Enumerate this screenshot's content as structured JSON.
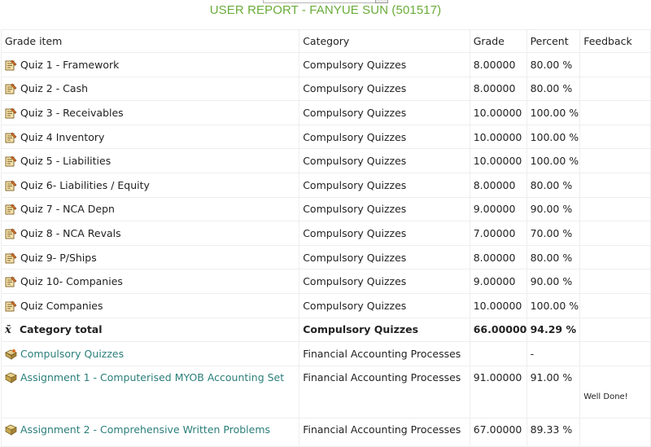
{
  "report_title": "USER REPORT - FANYUE SUN (501517)",
  "columns": {
    "item": "Grade item",
    "category": "Category",
    "grade": "Grade",
    "percent": "Percent",
    "feedback": "Feedback"
  },
  "rows": [
    {
      "item": "Quiz 1 - Framework",
      "category": "Compulsory Quizzes",
      "grade": "8.00000",
      "percent": "80.00 %",
      "feedback": ""
    },
    {
      "item": "Quiz 2 - Cash",
      "category": "Compulsory Quizzes",
      "grade": "8.00000",
      "percent": "80.00 %",
      "feedback": ""
    },
    {
      "item": "Quiz 3 - Receivables",
      "category": "Compulsory Quizzes",
      "grade": "10.00000",
      "percent": "100.00 %",
      "feedback": ""
    },
    {
      "item": "Quiz 4 Inventory",
      "category": "Compulsory Quizzes",
      "grade": "10.00000",
      "percent": "100.00 %",
      "feedback": ""
    },
    {
      "item": "Quiz 5 - Liabilities",
      "category": "Compulsory Quizzes",
      "grade": "10.00000",
      "percent": "100.00 %",
      "feedback": ""
    },
    {
      "item": "Quiz 6- Liabilities / Equity",
      "category": "Compulsory Quizzes",
      "grade": "8.00000",
      "percent": "80.00 %",
      "feedback": ""
    },
    {
      "item": "Quiz 7 - NCA Depn",
      "category": "Compulsory Quizzes",
      "grade": "9.00000",
      "percent": "90.00 %",
      "feedback": ""
    },
    {
      "item": "Quiz 8 - NCA Revals",
      "category": "Compulsory Quizzes",
      "grade": "7.00000",
      "percent": "70.00 %",
      "feedback": ""
    },
    {
      "item": "Quiz 9- P/Ships",
      "category": "Compulsory Quizzes",
      "grade": "8.00000",
      "percent": "80.00 %",
      "feedback": ""
    },
    {
      "item": "Quiz 10- Companies",
      "category": "Compulsory Quizzes",
      "grade": "9.00000",
      "percent": "90.00 %",
      "feedback": ""
    },
    {
      "item": "Quiz Companies",
      "category": "Compulsory Quizzes",
      "grade": "10.00000",
      "percent": "100.00 %",
      "feedback": ""
    }
  ],
  "category_total": {
    "item": "Category total",
    "category": "Compulsory Quizzes",
    "grade": "66.00000",
    "percent": "94.29 %",
    "symbol": "x̄"
  },
  "linked_rows": [
    {
      "item": "Compulsory Quizzes",
      "category": "Financial Accounting Processes",
      "grade": "",
      "percent": "-",
      "feedback": ""
    },
    {
      "item": "Assignment 1 - Computerised MYOB Accounting Set",
      "category": "Financial Accounting Processes",
      "grade": "91.00000",
      "percent": "91.00 %",
      "feedback": "Well Done!"
    },
    {
      "item": "Assignment 2 - Comprehensive Written Problems",
      "category": "Financial Accounting Processes",
      "grade": "67.00000",
      "percent": "89.33 %",
      "feedback": ""
    }
  ],
  "icons": {
    "quiz": "quiz-icon",
    "assignment": "assignment-icon",
    "category_link": "category-icon"
  }
}
